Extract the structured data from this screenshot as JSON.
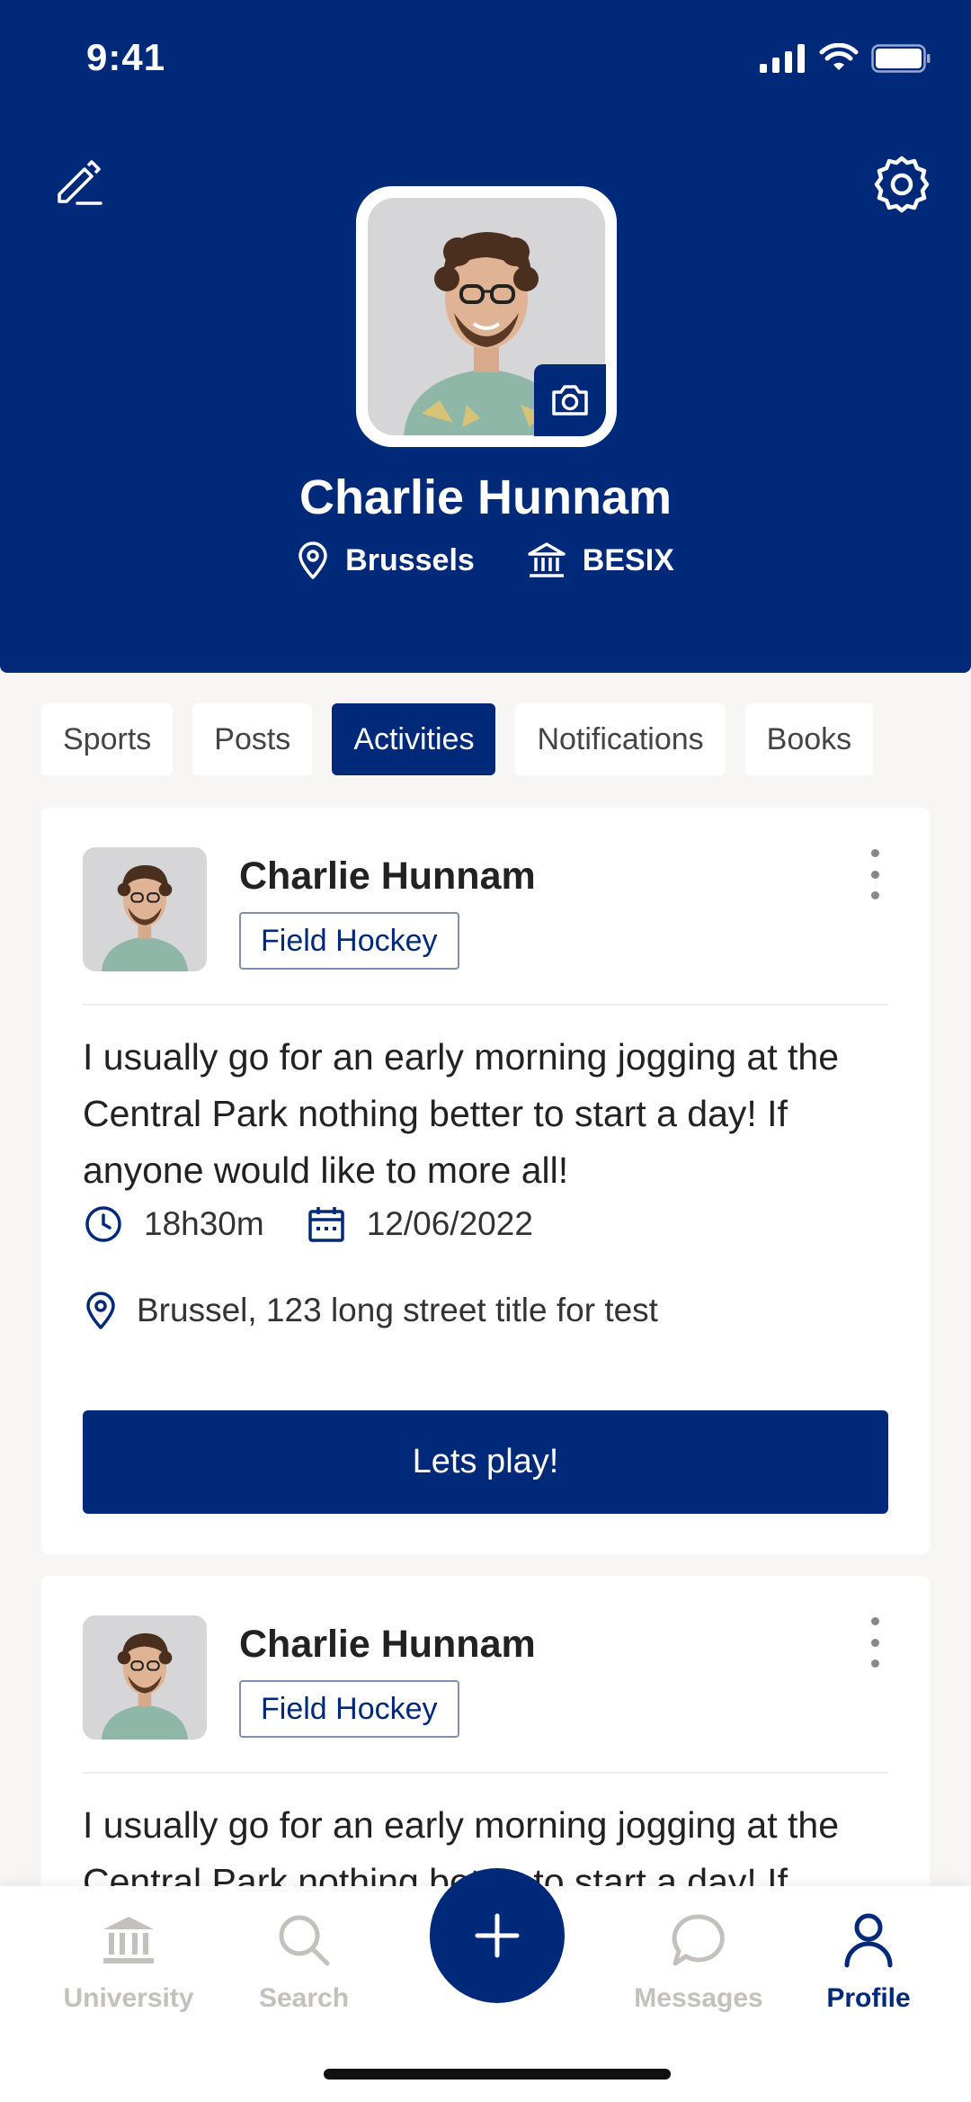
{
  "status_bar": {
    "time": "9:41"
  },
  "profile": {
    "name": "Charlie Hunnam",
    "location": "Brussels",
    "organization": "BESIX"
  },
  "tabs": [
    {
      "label": "Sports",
      "active": false
    },
    {
      "label": "Posts",
      "active": false
    },
    {
      "label": "Activities",
      "active": true
    },
    {
      "label": "Notifications",
      "active": false
    },
    {
      "label": "Books",
      "active": false
    }
  ],
  "activities": [
    {
      "author": "Charlie Hunnam",
      "sport_tag": "Field Hockey",
      "text": "I usually go for an early morning jogging at the Central Park nothing better to start a day! If anyone would like to more all!",
      "duration": "18h30m",
      "date": "12/06/2022",
      "location": "Brussel, 123 long street title for test",
      "action_label": "Lets play!"
    },
    {
      "author": "Charlie Hunnam",
      "sport_tag": "Field Hockey",
      "text": "I usually go for an early morning jogging at the Central Park nothing better to start a day! If anyone would like to more all!"
    }
  ],
  "bottom_nav": [
    {
      "label": "University",
      "icon": "university-icon",
      "active": false
    },
    {
      "label": "Search",
      "icon": "search-icon",
      "active": false
    },
    {
      "label": "Messages",
      "icon": "message-icon",
      "active": false
    },
    {
      "label": "Profile",
      "icon": "profile-icon",
      "active": true
    }
  ],
  "colors": {
    "primary": "#00297A",
    "background": "#F7F6F4",
    "inactive_nav": "#C4C1BD"
  }
}
